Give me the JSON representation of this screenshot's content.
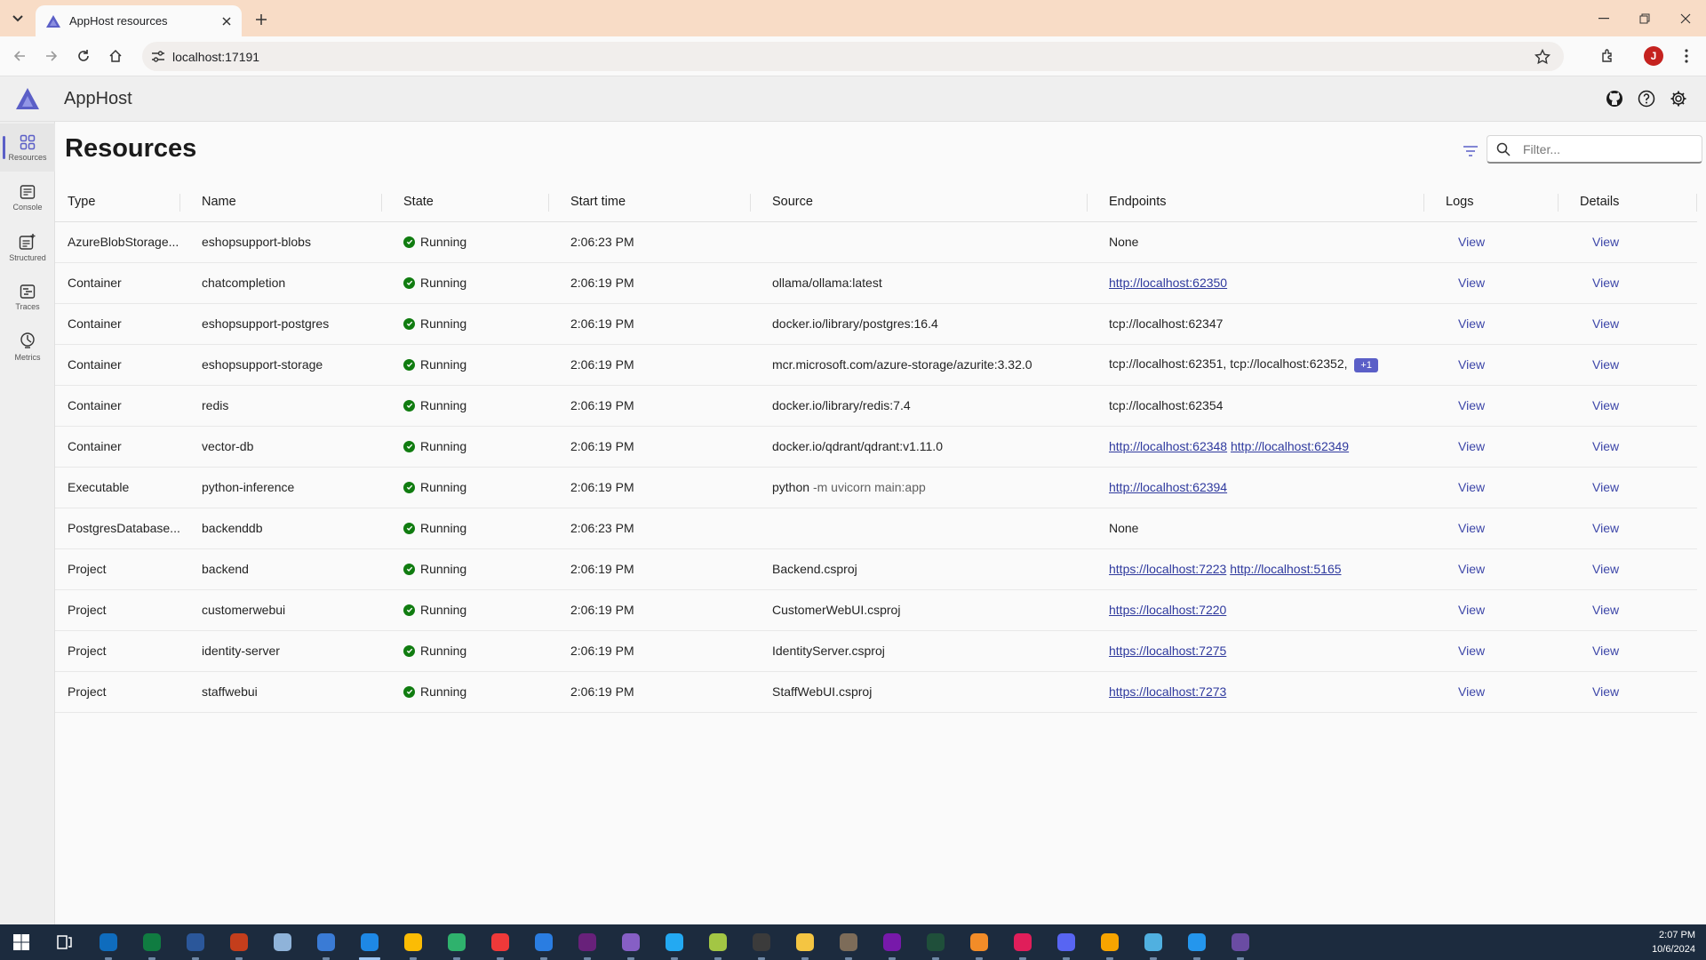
{
  "browser": {
    "tab_title": "AppHost resources",
    "url": "localhost:17191",
    "profile_initial": "J"
  },
  "app": {
    "title": "AppHost",
    "accent": "#5b5fc7"
  },
  "nav": [
    {
      "label": "Resources",
      "icon": "grid-icon"
    },
    {
      "label": "Console",
      "icon": "console-icon"
    },
    {
      "label": "Structured",
      "icon": "structured-logs-icon"
    },
    {
      "label": "Traces",
      "icon": "traces-icon"
    },
    {
      "label": "Metrics",
      "icon": "metrics-icon"
    }
  ],
  "page": {
    "title": "Resources",
    "filter_placeholder": "Filter..."
  },
  "columns": [
    "Type",
    "Name",
    "State",
    "Start time",
    "Source",
    "Endpoints",
    "Logs",
    "Details"
  ],
  "rows": [
    {
      "type": "AzureBlobStorage...",
      "name": "eshopsupport-blobs",
      "state": "Running",
      "start": "2:06:23 PM",
      "source": "",
      "source_args": "",
      "endpoints": [
        {
          "text": "None",
          "link": false
        }
      ],
      "extra": "",
      "logs": "View",
      "details": "View"
    },
    {
      "type": "Container",
      "name": "chatcompletion",
      "state": "Running",
      "start": "2:06:19 PM",
      "source": "ollama/ollama:latest",
      "source_args": "",
      "endpoints": [
        {
          "text": "http://localhost:62350",
          "link": true
        }
      ],
      "extra": "",
      "logs": "View",
      "details": "View"
    },
    {
      "type": "Container",
      "name": "eshopsupport-postgres",
      "state": "Running",
      "start": "2:06:19 PM",
      "source": "docker.io/library/postgres:16.4",
      "source_args": "",
      "endpoints": [
        {
          "text": "tcp://localhost:62347",
          "link": false
        }
      ],
      "extra": "",
      "logs": "View",
      "details": "View"
    },
    {
      "type": "Container",
      "name": "eshopsupport-storage",
      "state": "Running",
      "start": "2:06:19 PM",
      "source": "mcr.microsoft.com/azure-storage/azurite:3.32.0",
      "source_args": "",
      "endpoints": [
        {
          "text": "tcp://localhost:62351,",
          "link": false
        },
        {
          "text": "tcp://localhost:62352,",
          "link": false
        }
      ],
      "extra": "+1",
      "logs": "View",
      "details": "View"
    },
    {
      "type": "Container",
      "name": "redis",
      "state": "Running",
      "start": "2:06:19 PM",
      "source": "docker.io/library/redis:7.4",
      "source_args": "",
      "endpoints": [
        {
          "text": "tcp://localhost:62354",
          "link": false
        }
      ],
      "extra": "",
      "logs": "View",
      "details": "View"
    },
    {
      "type": "Container",
      "name": "vector-db",
      "state": "Running",
      "start": "2:06:19 PM",
      "source": "docker.io/qdrant/qdrant:v1.11.0",
      "source_args": "",
      "endpoints": [
        {
          "text": "http://localhost:62348",
          "link": true
        },
        {
          "text": "http://localhost:62349",
          "link": true
        }
      ],
      "extra": "",
      "logs": "View",
      "details": "View"
    },
    {
      "type": "Executable",
      "name": "python-inference",
      "state": "Running",
      "start": "2:06:19 PM",
      "source": "python",
      "source_args": "-m uvicorn main:app",
      "endpoints": [
        {
          "text": "http://localhost:62394",
          "link": true
        }
      ],
      "extra": "",
      "logs": "View",
      "details": "View"
    },
    {
      "type": "PostgresDatabase...",
      "name": "backenddb",
      "state": "Running",
      "start": "2:06:23 PM",
      "source": "",
      "source_args": "",
      "endpoints": [
        {
          "text": "None",
          "link": false
        }
      ],
      "extra": "",
      "logs": "View",
      "details": "View"
    },
    {
      "type": "Project",
      "name": "backend",
      "state": "Running",
      "start": "2:06:19 PM",
      "source": "Backend.csproj",
      "source_args": "",
      "endpoints": [
        {
          "text": "https://localhost:7223",
          "link": true
        },
        {
          "text": "http://localhost:5165",
          "link": true
        }
      ],
      "extra": "",
      "logs": "View",
      "details": "View"
    },
    {
      "type": "Project",
      "name": "customerwebui",
      "state": "Running",
      "start": "2:06:19 PM",
      "source": "CustomerWebUI.csproj",
      "source_args": "",
      "endpoints": [
        {
          "text": "https://localhost:7220",
          "link": true
        }
      ],
      "extra": "",
      "logs": "View",
      "details": "View"
    },
    {
      "type": "Project",
      "name": "identity-server",
      "state": "Running",
      "start": "2:06:19 PM",
      "source": "IdentityServer.csproj",
      "source_args": "",
      "endpoints": [
        {
          "text": "https://localhost:7275",
          "link": true
        }
      ],
      "extra": "",
      "logs": "View",
      "details": "View"
    },
    {
      "type": "Project",
      "name": "staffwebui",
      "state": "Running",
      "start": "2:06:19 PM",
      "source": "StaffWebUI.csproj",
      "source_args": "",
      "endpoints": [
        {
          "text": "https://localhost:7273",
          "link": true
        }
      ],
      "extra": "",
      "logs": "View",
      "details": "View"
    }
  ],
  "taskbar": {
    "time": "2:07 PM",
    "date": "10/6/2024",
    "apps": [
      {
        "name": "start-icon",
        "color": "#ffffff"
      },
      {
        "name": "task-view-icon",
        "color": "#ffffff"
      },
      {
        "name": "outlook-icon",
        "color": "#0f6cbd"
      },
      {
        "name": "excel-icon",
        "color": "#107c41"
      },
      {
        "name": "word-icon",
        "color": "#2b579a"
      },
      {
        "name": "powerpoint-icon",
        "color": "#c43e1c"
      },
      {
        "name": "notepad-icon",
        "color": "#8fb3d9"
      },
      {
        "name": "paint-icon",
        "color": "#3a7bd5"
      },
      {
        "name": "terminal-app-icon",
        "color": "#1e88e5"
      },
      {
        "name": "chrome-icon",
        "color": "#fbbc04"
      },
      {
        "name": "edge-icon",
        "color": "#2fb26d"
      },
      {
        "name": "vivaldi-icon",
        "color": "#ef3939"
      },
      {
        "name": "firefox-icon",
        "color": "#2a7de1"
      },
      {
        "name": "visual-studio-icon",
        "color": "#68217a"
      },
      {
        "name": "visual-studio-preview-icon",
        "color": "#865fc5"
      },
      {
        "name": "vscode-icon",
        "color": "#23a9f2"
      },
      {
        "name": "snipping-icon",
        "color": "#a3c644"
      },
      {
        "name": "console-app-icon",
        "color": "#3b3b3b"
      },
      {
        "name": "file-explorer-icon",
        "color": "#f4c542"
      },
      {
        "name": "gimp-icon",
        "color": "#7d6c59"
      },
      {
        "name": "onenote-icon",
        "color": "#7719aa"
      },
      {
        "name": "ai-app-icon",
        "color": "#1f4f3a"
      },
      {
        "name": "browser-app-icon",
        "color": "#f28c28"
      },
      {
        "name": "slack-icon",
        "color": "#e01e5a"
      },
      {
        "name": "discord-icon",
        "color": "#5865f2"
      },
      {
        "name": "media-player-icon",
        "color": "#f7a400"
      },
      {
        "name": "storage-explorer-icon",
        "color": "#50b0e0"
      },
      {
        "name": "docker-icon",
        "color": "#2496ed"
      },
      {
        "name": "terminal-icon",
        "color": "#6a4ca3"
      }
    ]
  }
}
